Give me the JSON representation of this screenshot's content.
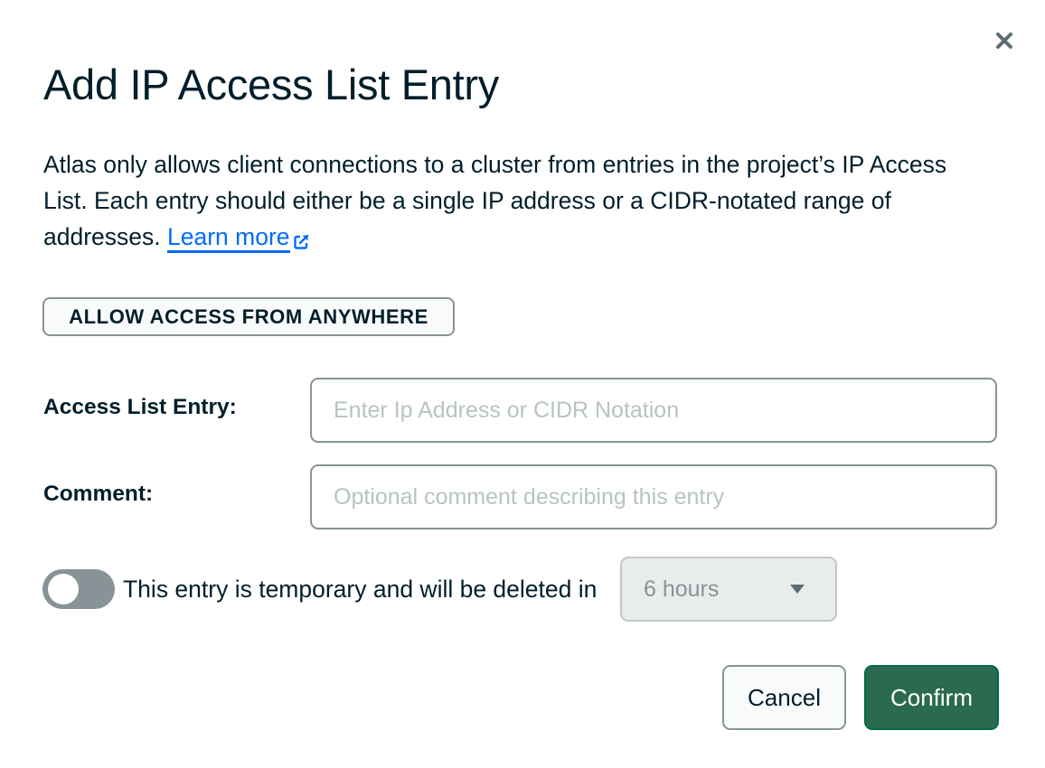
{
  "dialog": {
    "title": "Add IP Access List Entry",
    "close_icon": "close-icon",
    "description": "Atlas only allows client connections to a cluster from entries in the project’s IP Access List. Each entry should either be a single IP address or a CIDR-notated range of addresses. ",
    "learn_more_label": "Learn more",
    "external_link_icon": "external-link-icon"
  },
  "allow_anywhere": {
    "label": "ALLOW ACCESS FROM ANYWHERE"
  },
  "form": {
    "access_entry": {
      "label": "Access List Entry:",
      "value": "",
      "placeholder": "Enter Ip Address or CIDR Notation"
    },
    "comment": {
      "label": "Comment:",
      "value": "",
      "placeholder": "Optional comment describing this entry"
    },
    "temporary": {
      "enabled": false,
      "label": "This entry is temporary and will be deleted in",
      "duration_selected": "6 hours"
    }
  },
  "footer": {
    "cancel_label": "Cancel",
    "confirm_label": "Confirm"
  },
  "colors": {
    "text": "#001e2b",
    "link": "#016bf8",
    "confirm_bg": "#2a6a4f",
    "border": "#889397",
    "placeholder": "#b8c4c2"
  }
}
